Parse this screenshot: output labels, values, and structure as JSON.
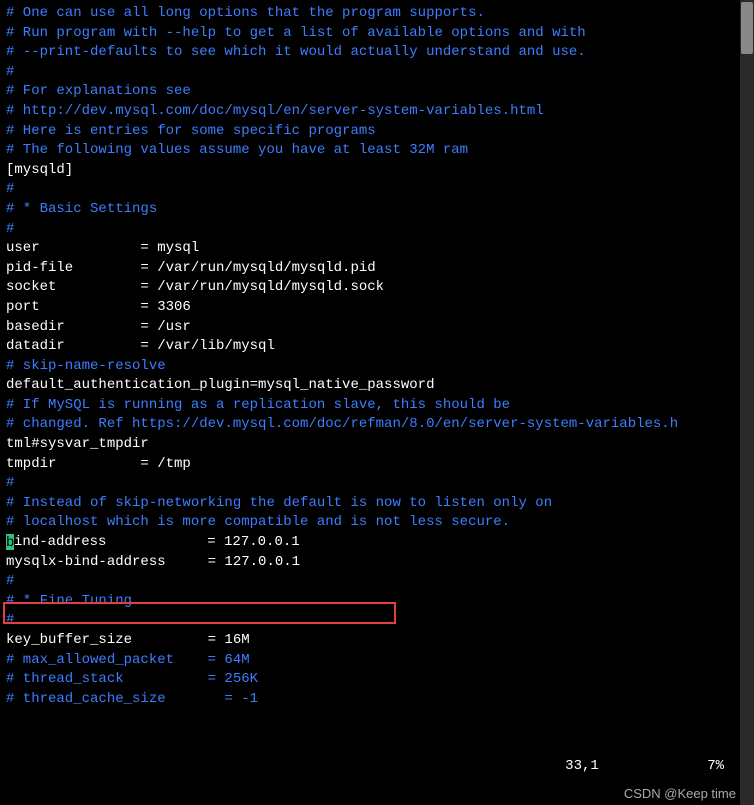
{
  "lines": {
    "l1": "# One can use all long options that the program supports.",
    "l2": "# Run program with --help to get a list of available options and with",
    "l3": "# --print-defaults to see which it would actually understand and use.",
    "l4": "#",
    "l5": "# For explanations see",
    "l6": "# http://dev.mysql.com/doc/mysql/en/server-system-variables.html",
    "l7": "",
    "l8": "# Here is entries for some specific programs",
    "l9": "# The following values assume you have at least 32M ram",
    "l10": "",
    "l11": "[mysqld]",
    "l12": "#",
    "l13": "# * Basic Settings",
    "l14": "#",
    "l15": "user            = mysql",
    "l16": "pid-file        = /var/run/mysqld/mysqld.pid",
    "l17": "socket          = /var/run/mysqld/mysqld.sock",
    "l18": "port            = 3306",
    "l19": "basedir         = /usr",
    "l20": "datadir         = /var/lib/mysql",
    "l21": "# skip-name-resolve",
    "l22": "default_authentication_plugin=mysql_native_password",
    "l23": "",
    "l24": "# If MySQL is running as a replication slave, this should be",
    "l25": "# changed. Ref https://dev.mysql.com/doc/refman/8.0/en/server-system-variables.h",
    "l26": "tml#sysvar_tmpdir",
    "l27": "tmpdir          = /tmp",
    "l28": "#",
    "l29": "# Instead of skip-networking the default is now to listen only on",
    "l30": "# localhost which is more compatible and is not less secure.",
    "l31a": "b",
    "l31b": "ind-address            = 127.0.0.1",
    "l32": "mysqlx-bind-address     = 127.0.0.1",
    "l33": "#",
    "l34": "# * Fine Tuning",
    "l35": "#",
    "l36": "key_buffer_size         = 16M",
    "l37": "# max_allowed_packet    = 64M",
    "l38": "# thread_stack          = 256K",
    "l39": "",
    "l40": "# thread_cache_size       = -1"
  },
  "status": {
    "position": "33,1",
    "percent": "7%"
  },
  "watermark": "CSDN @Keep time"
}
